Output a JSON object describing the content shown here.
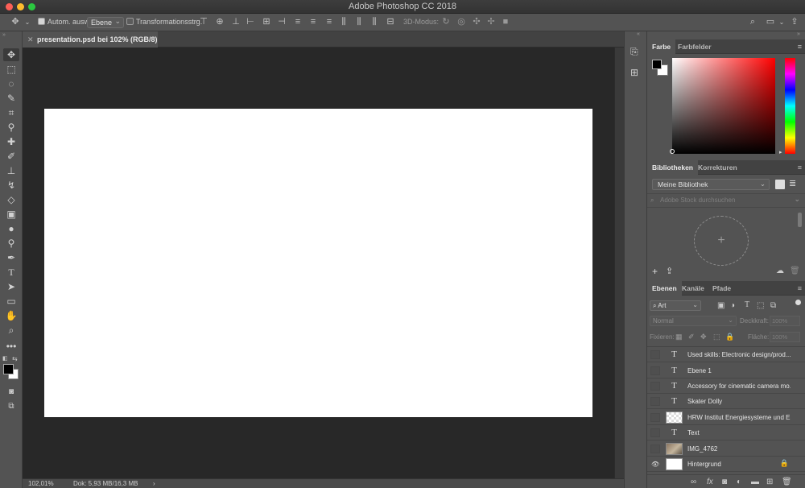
{
  "window": {
    "title": "Adobe Photoshop CC 2018",
    "traffic_colors": [
      "#fc5f57",
      "#fdbb2e",
      "#2bc840"
    ]
  },
  "options_bar": {
    "auto_select_label": "Autom. ausw.:",
    "auto_select_checked": true,
    "auto_select_target": "Ebene",
    "transform_controls_label": "Transformationsstrg.",
    "mode_3d_label": "3D-Modus:"
  },
  "document": {
    "tab_title": "presentation.psd bei 102% (RGB/8) *",
    "zoom": "102,01%",
    "doc_size": "Dok: 5,93 MB/16,3 MB"
  },
  "color_panel": {
    "tabs": [
      "Farbe",
      "Farbfelder"
    ],
    "hue": "#ff0000"
  },
  "libraries_panel": {
    "tabs": [
      "Bibliotheken",
      "Korrekturen"
    ],
    "library": "Meine Bibliothek",
    "search_placeholder": "Adobe Stock durchsuchen"
  },
  "layers_panel": {
    "tabs": [
      "Ebenen",
      "Kanäle",
      "Pfade"
    ],
    "filter_kind": "Art",
    "blend_mode": "Normal",
    "opacity_label": "Deckkraft:",
    "opacity_value": "100%",
    "lock_label": "Fixieren:",
    "fill_label": "Fläche:",
    "fill_value": "100%",
    "layers": [
      {
        "name": "Used skills: Electronic design/prod...",
        "type": "text",
        "visible": false
      },
      {
        "name": "Ebene 1",
        "type": "text",
        "visible": false
      },
      {
        "name": "Accessory for cinematic camera mo...",
        "type": "text",
        "visible": false
      },
      {
        "name": "Skater Dolly",
        "type": "text",
        "visible": false
      },
      {
        "name": "HRW Institut Energiesysteme und E...",
        "type": "smart",
        "visible": false
      },
      {
        "name": "Text",
        "type": "text",
        "visible": false
      },
      {
        "name": "IMG_4762",
        "type": "smart",
        "visible": false
      },
      {
        "name": "Hintergrund",
        "type": "background",
        "visible": true,
        "locked": true
      }
    ]
  }
}
